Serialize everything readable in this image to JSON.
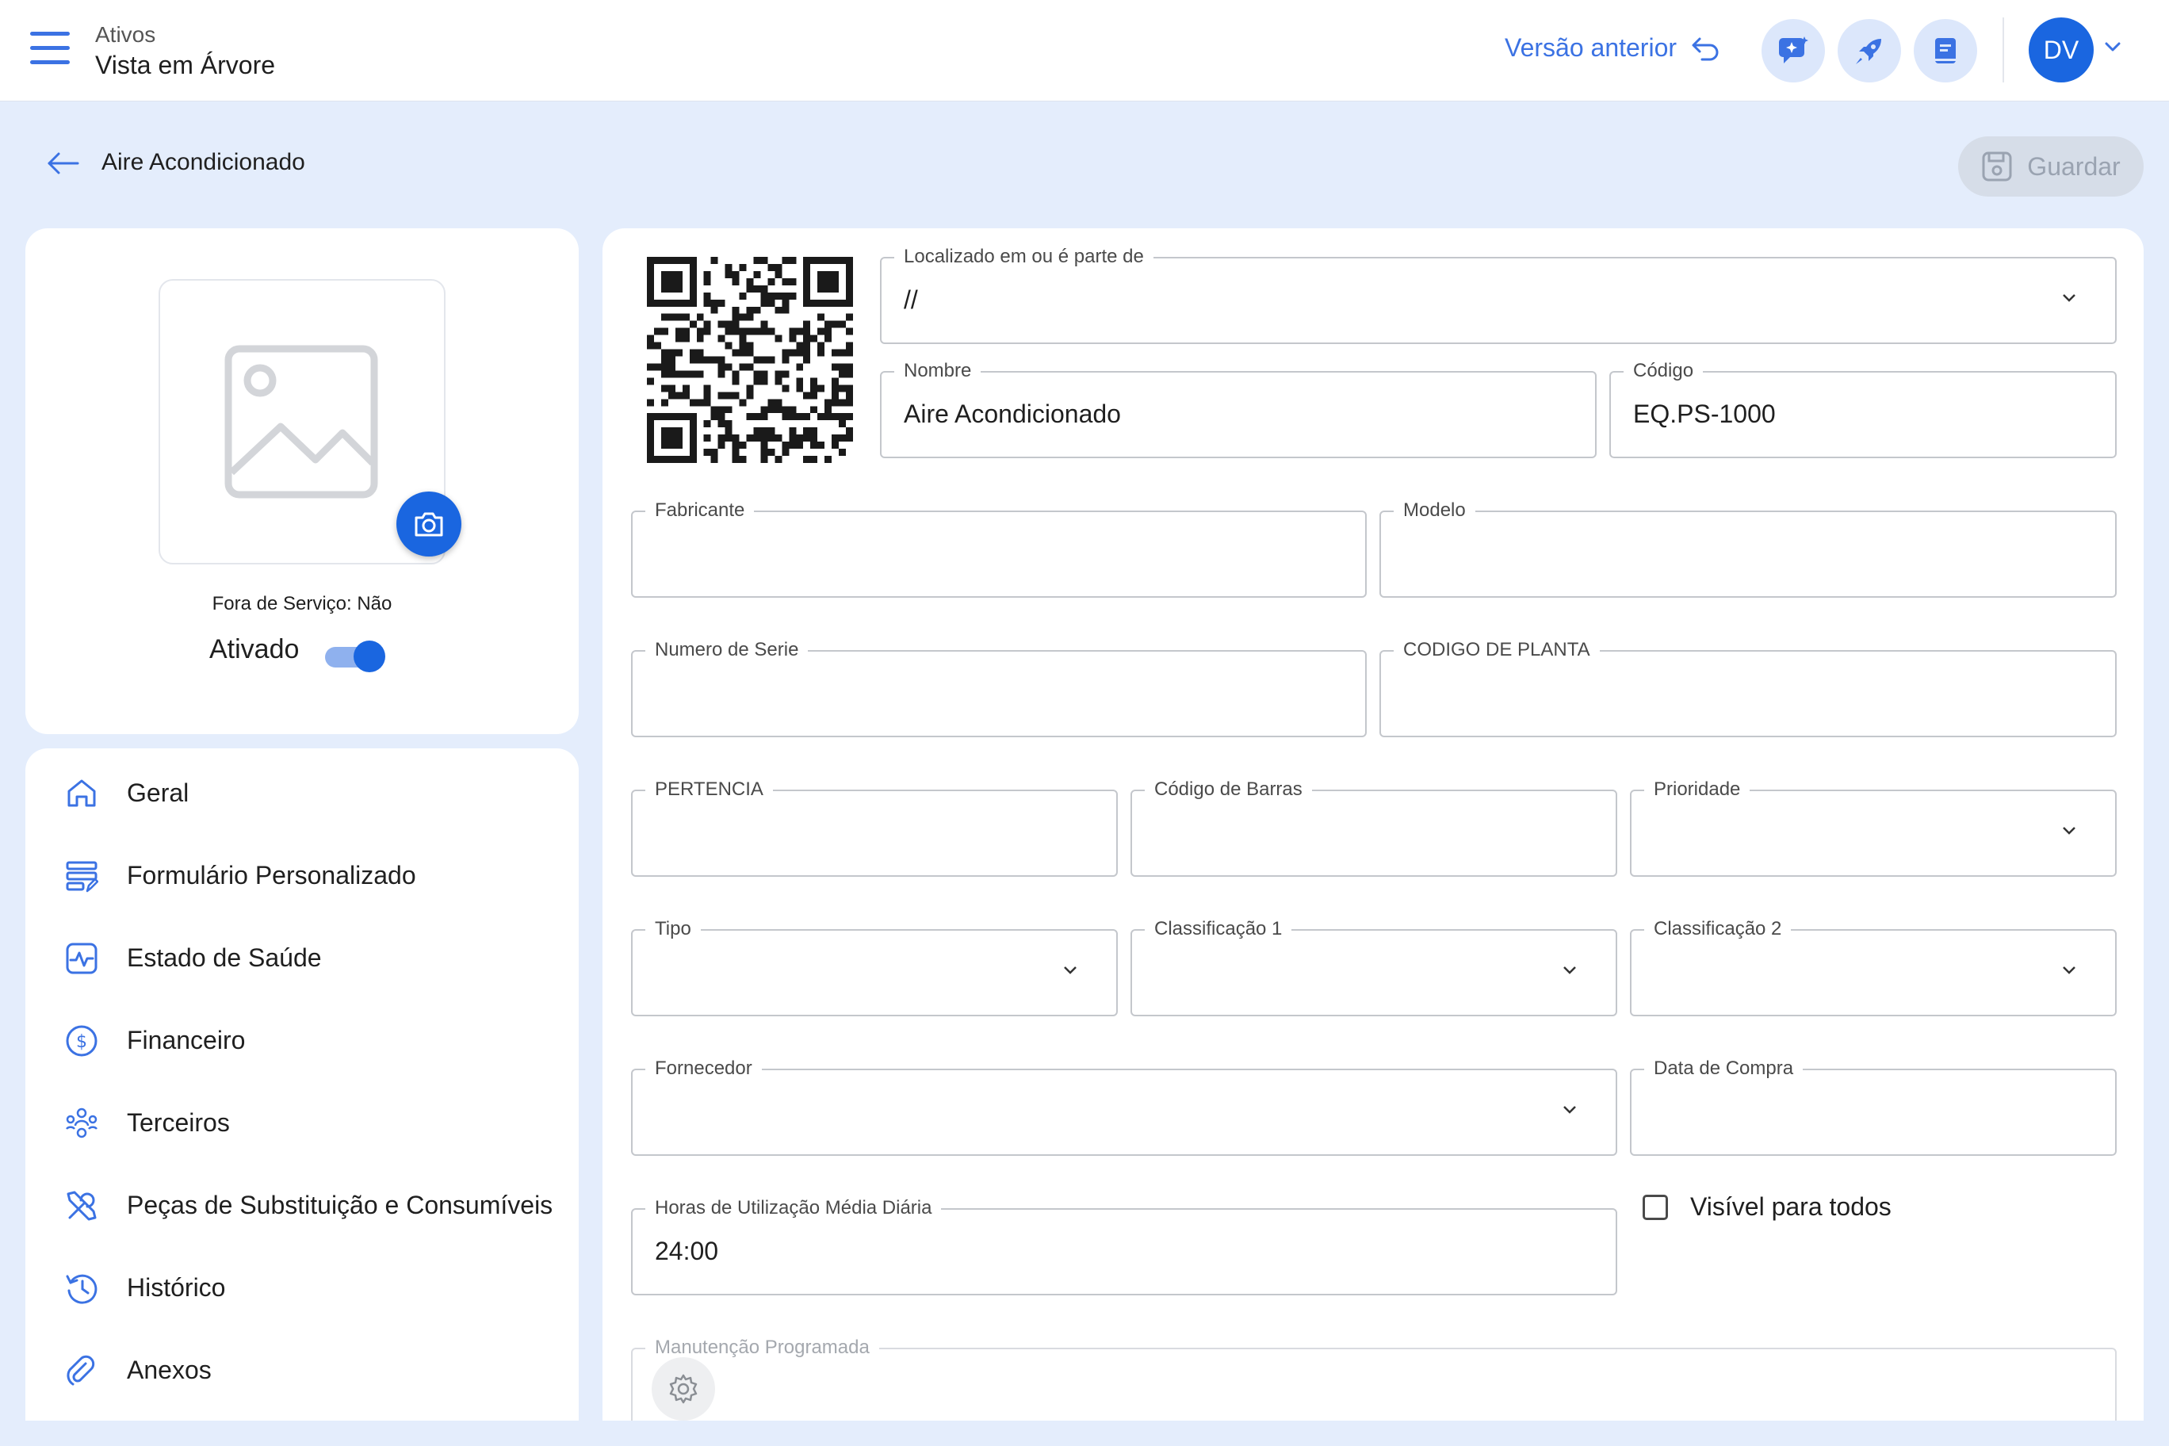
{
  "header": {
    "breadcrumb_parent": "Ativos",
    "breadcrumb_current": "Vista em Árvore",
    "previous_version_label": "Versão anterior",
    "avatar_initials": "DV"
  },
  "page": {
    "title": "Aire Acondicionado",
    "save_label": "Guardar"
  },
  "asset_card": {
    "out_of_service_text": "Fora de Serviço: Não",
    "activated_label": "Ativado",
    "activated": true
  },
  "nav": {
    "items": [
      {
        "label": "Geral",
        "icon": "home-icon"
      },
      {
        "label": "Formulário Personalizado",
        "icon": "custom-form-icon"
      },
      {
        "label": "Estado de Saúde",
        "icon": "health-icon"
      },
      {
        "label": "Financeiro",
        "icon": "dollar-icon"
      },
      {
        "label": "Terceiros",
        "icon": "third-parties-icon"
      },
      {
        "label": "Peças de Substituição e Consumíveis",
        "icon": "tools-icon"
      },
      {
        "label": "Histórico",
        "icon": "history-icon"
      },
      {
        "label": "Anexos",
        "icon": "attachment-icon"
      }
    ]
  },
  "form": {
    "location": {
      "label": "Localizado em ou é parte de",
      "value": "//"
    },
    "name": {
      "label": "Nombre",
      "value": "Aire Acondicionado"
    },
    "code": {
      "label": "Código",
      "value": "EQ.PS-1000"
    },
    "manufacturer": {
      "label": "Fabricante",
      "value": ""
    },
    "model": {
      "label": "Modelo",
      "value": ""
    },
    "serial_number": {
      "label": "Numero de Serie",
      "value": ""
    },
    "plant_code": {
      "label": "CODIGO DE PLANTA",
      "value": ""
    },
    "pertencia": {
      "label": "PERTENCIA",
      "value": ""
    },
    "barcode": {
      "label": "Código de Barras",
      "value": ""
    },
    "priority": {
      "label": "Prioridade",
      "value": ""
    },
    "type": {
      "label": "Tipo",
      "value": ""
    },
    "classification1": {
      "label": "Classificação 1",
      "value": ""
    },
    "classification2": {
      "label": "Classificação 2",
      "value": ""
    },
    "supplier": {
      "label": "Fornecedor",
      "value": ""
    },
    "purchase_date": {
      "label": "Data de Compra",
      "value": ""
    },
    "daily_hours": {
      "label": "Horas de Utilização Média Diária",
      "value": "24:00"
    },
    "visible_to_all": {
      "label": "Visível para todos",
      "checked": false
    },
    "scheduled_maintenance": {
      "label": "Manutenção Programada"
    }
  },
  "colors": {
    "accent": "#1a66e0",
    "link": "#3b72e3",
    "background": "#e4edfc"
  }
}
